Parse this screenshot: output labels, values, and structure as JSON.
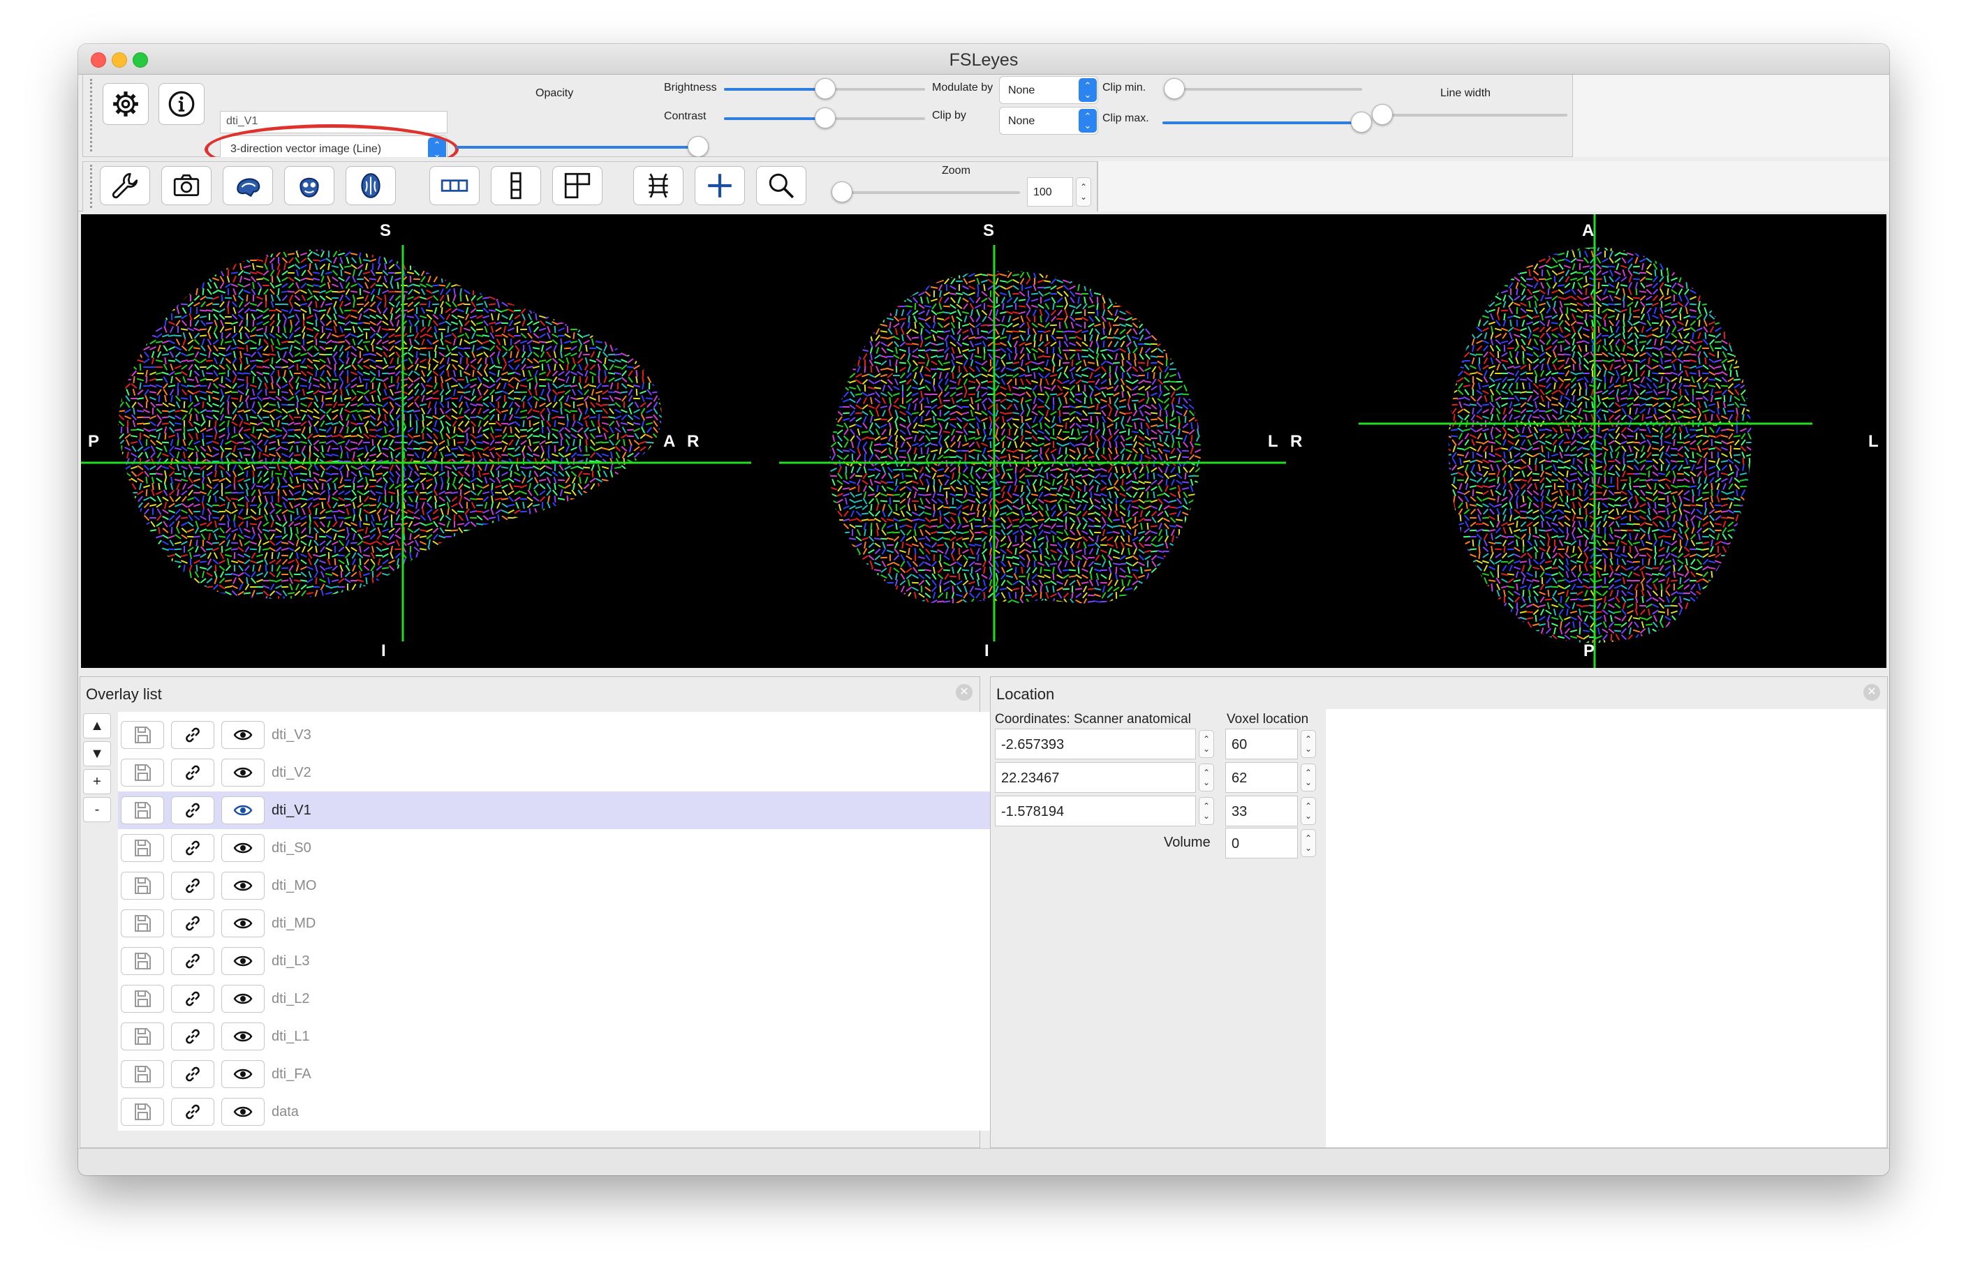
{
  "window": {
    "title": "FSLeyes"
  },
  "overlay_toolbar": {
    "overlay_name": "dti_V1",
    "overlay_type": "3-direction vector image (Line)",
    "opacity_label": "Opacity",
    "opacity_value": 1.0,
    "brightness_label": "Brightness",
    "brightness_value": 0.5,
    "contrast_label": "Contrast",
    "contrast_value": 0.5,
    "modulate_by_label": "Modulate by",
    "modulate_by_value": "None",
    "clip_by_label": "Clip by",
    "clip_by_value": "None",
    "clip_min_label": "Clip min.",
    "clip_min_value": 0.0,
    "clip_max_label": "Clip max.",
    "clip_max_value": 1.0,
    "line_width_label": "Line width",
    "line_width_value": 0.0
  },
  "view_toolbar": {
    "zoom_label": "Zoom",
    "zoom_value": "100",
    "icons": [
      "wrench-icon",
      "camera-icon",
      "sagittal-view-icon",
      "coronal-view-icon",
      "axial-view-icon",
      "horizontal-layout-icon",
      "vertical-layout-icon",
      "grid-layout-icon",
      "movie-mode-icon",
      "crosshair-icon",
      "zoom-icon"
    ]
  },
  "canvas": {
    "sagittal": {
      "top": "S",
      "bottom": "I",
      "left": "P",
      "right": "A"
    },
    "coronal": {
      "top": "S",
      "bottom": "I",
      "left": "R",
      "right": "L"
    },
    "axial": {
      "top": "A",
      "bottom": "P",
      "left": "R",
      "right": "L"
    },
    "crosshair_color": "#22dd22"
  },
  "overlay_list": {
    "title": "Overlay list",
    "controls": [
      "▲",
      "▼",
      "+",
      "-"
    ],
    "items": [
      {
        "name": "dti_V3",
        "selected": false
      },
      {
        "name": "dti_V2",
        "selected": false
      },
      {
        "name": "dti_V1",
        "selected": true
      },
      {
        "name": "dti_S0",
        "selected": false
      },
      {
        "name": "dti_MO",
        "selected": false
      },
      {
        "name": "dti_MD",
        "selected": false
      },
      {
        "name": "dti_L3",
        "selected": false
      },
      {
        "name": "dti_L2",
        "selected": false
      },
      {
        "name": "dti_L1",
        "selected": false
      },
      {
        "name": "dti_FA",
        "selected": false
      },
      {
        "name": "data",
        "selected": false
      }
    ]
  },
  "location": {
    "title": "Location",
    "coords_header": "Coordinates: Scanner anatomical",
    "voxel_header": "Voxel location",
    "coords": [
      "-2.657393",
      "22.23467",
      "-1.578194"
    ],
    "voxels": [
      "60",
      "62",
      "33"
    ],
    "volume_label": "Volume",
    "volume_value": "0"
  },
  "colors": {
    "selection": "#dcdcf8",
    "slider_fill": "#2f7fe0",
    "annotation_ellipse": "#e0322c"
  }
}
